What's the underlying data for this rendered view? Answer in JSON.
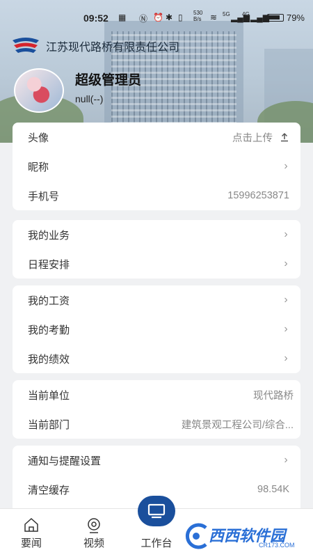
{
  "status_bar": {
    "time": "09:52",
    "net_speed": "530\nB/s",
    "signal1": "5G",
    "signal2": "4G",
    "battery": "79%"
  },
  "company": {
    "name": "江苏现代路桥有限责任公司"
  },
  "profile": {
    "name": "超级管理员",
    "sub": "null(--)"
  },
  "cards": [
    {
      "rows": [
        {
          "label": "头像",
          "value": "点击上传",
          "icon": "upload-icon"
        },
        {
          "label": "昵称",
          "value": "",
          "icon": "chevron-right-icon"
        },
        {
          "label": "手机号",
          "value": "15996253871",
          "icon": ""
        }
      ]
    },
    {
      "rows": [
        {
          "label": "我的业务",
          "value": "",
          "icon": "chevron-right-icon"
        },
        {
          "label": "日程安排",
          "value": "",
          "icon": "chevron-right-icon"
        }
      ]
    },
    {
      "rows": [
        {
          "label": "我的工资",
          "value": "",
          "icon": "chevron-right-icon"
        },
        {
          "label": "我的考勤",
          "value": "",
          "icon": "chevron-right-icon"
        },
        {
          "label": "我的绩效",
          "value": "",
          "icon": "chevron-right-icon"
        }
      ]
    },
    {
      "rows": [
        {
          "label": "当前单位",
          "value": "现代路桥",
          "icon": ""
        },
        {
          "label": "当前部门",
          "value": "建筑景观工程公司/综合...",
          "icon": ""
        }
      ]
    },
    {
      "rows": [
        {
          "label": "通知与提醒设置",
          "value": "",
          "icon": "chevron-right-icon"
        },
        {
          "label": "清空缓存",
          "value": "98.54K",
          "icon": ""
        }
      ]
    }
  ],
  "tabbar": {
    "tabs": [
      {
        "label": "要闻",
        "icon": "home-icon"
      },
      {
        "label": "视频",
        "icon": "camera-icon"
      },
      {
        "label": "工作台",
        "icon": "monitor-icon"
      }
    ]
  },
  "watermark": {
    "text": "西西软件园",
    "url": "CR173.COM"
  },
  "colors": {
    "accent": "#1a4f9c",
    "card_bg": "#ffffff",
    "page_bg": "#f0f1f3"
  }
}
